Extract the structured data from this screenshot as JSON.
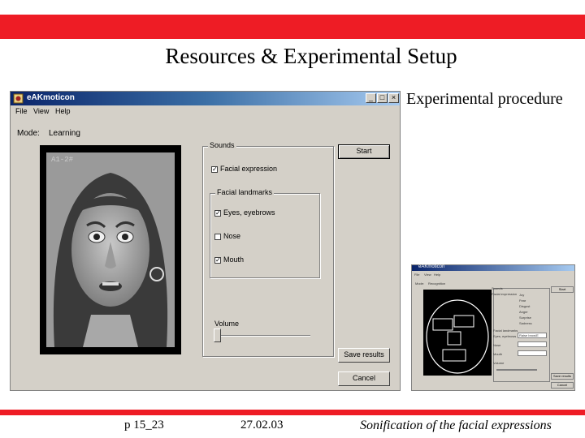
{
  "slide": {
    "title": "Resources & Experimental Setup",
    "caption": "Experimental procedure",
    "footer": {
      "page": "p 15_23",
      "date": "27.02.03",
      "subject": "Sonification of the facial expressions"
    }
  },
  "colors": {
    "accent_red": "#ee1c25",
    "window_face": "#d4d0c8",
    "titlebar": "#0a246a"
  },
  "app": {
    "title": "eAKmoticon",
    "icon": "app-icon",
    "window_buttons": {
      "minimize": "_",
      "maximize": "□",
      "close": "×"
    },
    "menu": [
      "File",
      "View",
      "Help"
    ],
    "mode_label": "Mode:",
    "mode_value": "Learning",
    "photo_label": "A1-2#",
    "sounds_group": {
      "title": "Sounds",
      "facial_expression": {
        "label": "Facial expression",
        "checked": true
      },
      "features_group": {
        "title": "Facial landmarks",
        "items": [
          {
            "label": "Eyes, eyebrows",
            "checked": true
          },
          {
            "label": "Nose",
            "checked": false
          },
          {
            "label": "Mouth",
            "checked": true
          }
        ]
      },
      "volume_label": "Volume",
      "volume_level": 0
    },
    "buttons": {
      "start": "Start",
      "save_results": "Save results",
      "cancel": "Cancel"
    }
  },
  "thumbnail": {
    "title": "eAKmoticon",
    "menu": [
      "File",
      "View",
      "Help"
    ],
    "mode_label": "Mode:",
    "mode_value": "Recognition",
    "sounds_title": "Sounds",
    "expression_label": "Facial expression",
    "expressions": [
      "Joy",
      "Fear",
      "Disgust",
      "Anger",
      "Surprise",
      "Sadness"
    ],
    "landmarks_label": "Facial landmarks",
    "fields": [
      "Eyes, eyebrows",
      "Nose",
      "Mouth"
    ],
    "eyes_value": "Raise brow/E",
    "volume_label": "Volume",
    "buttons": {
      "start": "Start",
      "save": "Save results",
      "cancel": "Cancel"
    }
  }
}
